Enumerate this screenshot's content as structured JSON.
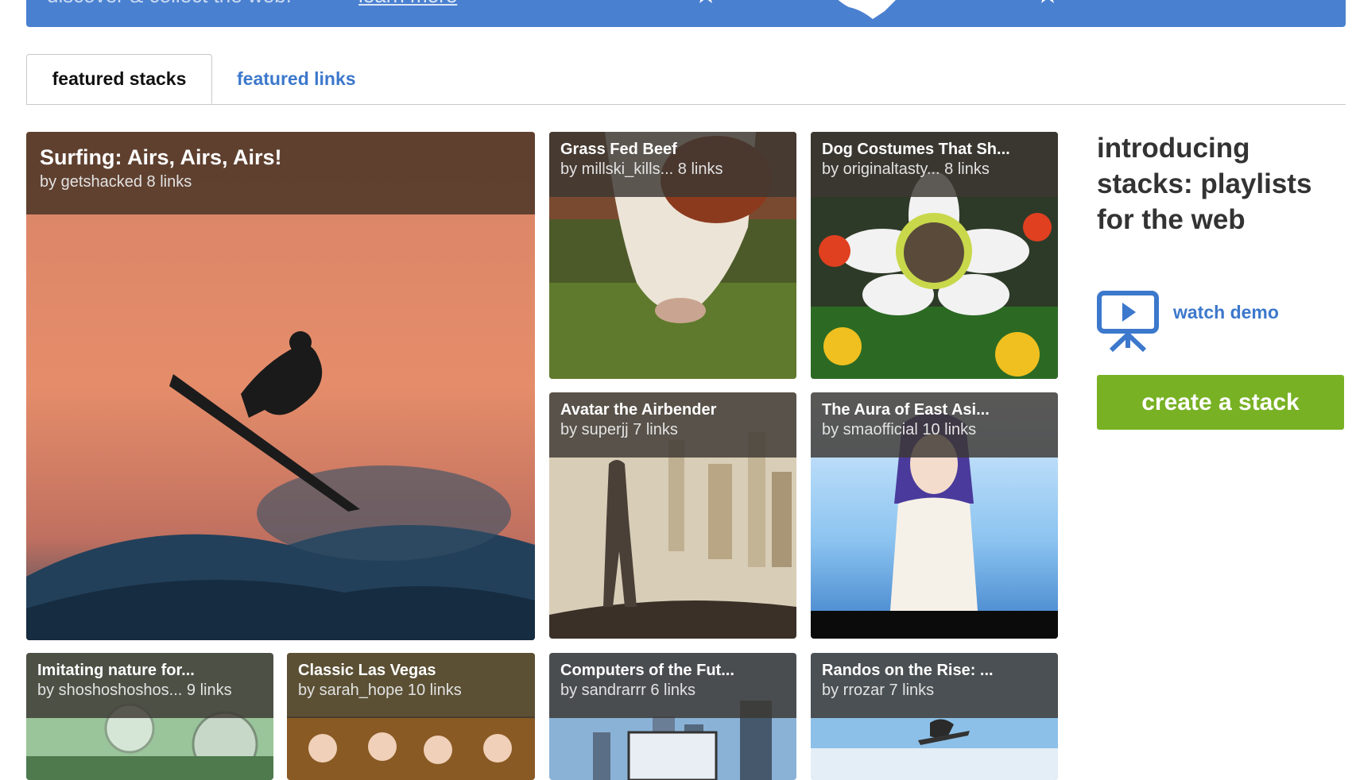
{
  "banner": {
    "tagline": "discover & collect the web.",
    "learn_more": "learn more",
    "color": "#4a80d0"
  },
  "tabs": [
    {
      "label": "featured stacks",
      "active": true
    },
    {
      "label": "featured links",
      "active": false
    }
  ],
  "stacks": [
    {
      "title": "Surfing: Airs, Airs, Airs!",
      "byline": "by getshacked 8 links"
    },
    {
      "title": "Grass Fed Beef",
      "byline": "by millski_kills... 8 links"
    },
    {
      "title": "Dog Costumes That Sh...",
      "byline": "by originaltasty... 8 links"
    },
    {
      "title": "Avatar the Airbender",
      "byline": "by superjj 7 links"
    },
    {
      "title": "The Aura of East Asi...",
      "byline": "by smaofficial 10 links"
    },
    {
      "title": "Imitating nature for...",
      "byline": "by shoshoshoshos... 9 links"
    },
    {
      "title": "Classic Las Vegas",
      "byline": "by sarah_hope 10 links"
    },
    {
      "title": "Computers of the Fut...",
      "byline": "by sandrarrr 6 links"
    },
    {
      "title": "Randos on the Rise: ...",
      "byline": "by rrozar 7 links"
    }
  ],
  "sidebar": {
    "heading": "introducing stacks: playlists for the web",
    "watch_demo": "watch demo",
    "create_button": "create a stack",
    "accent": "#3c78cc",
    "button_color": "#78b124"
  }
}
